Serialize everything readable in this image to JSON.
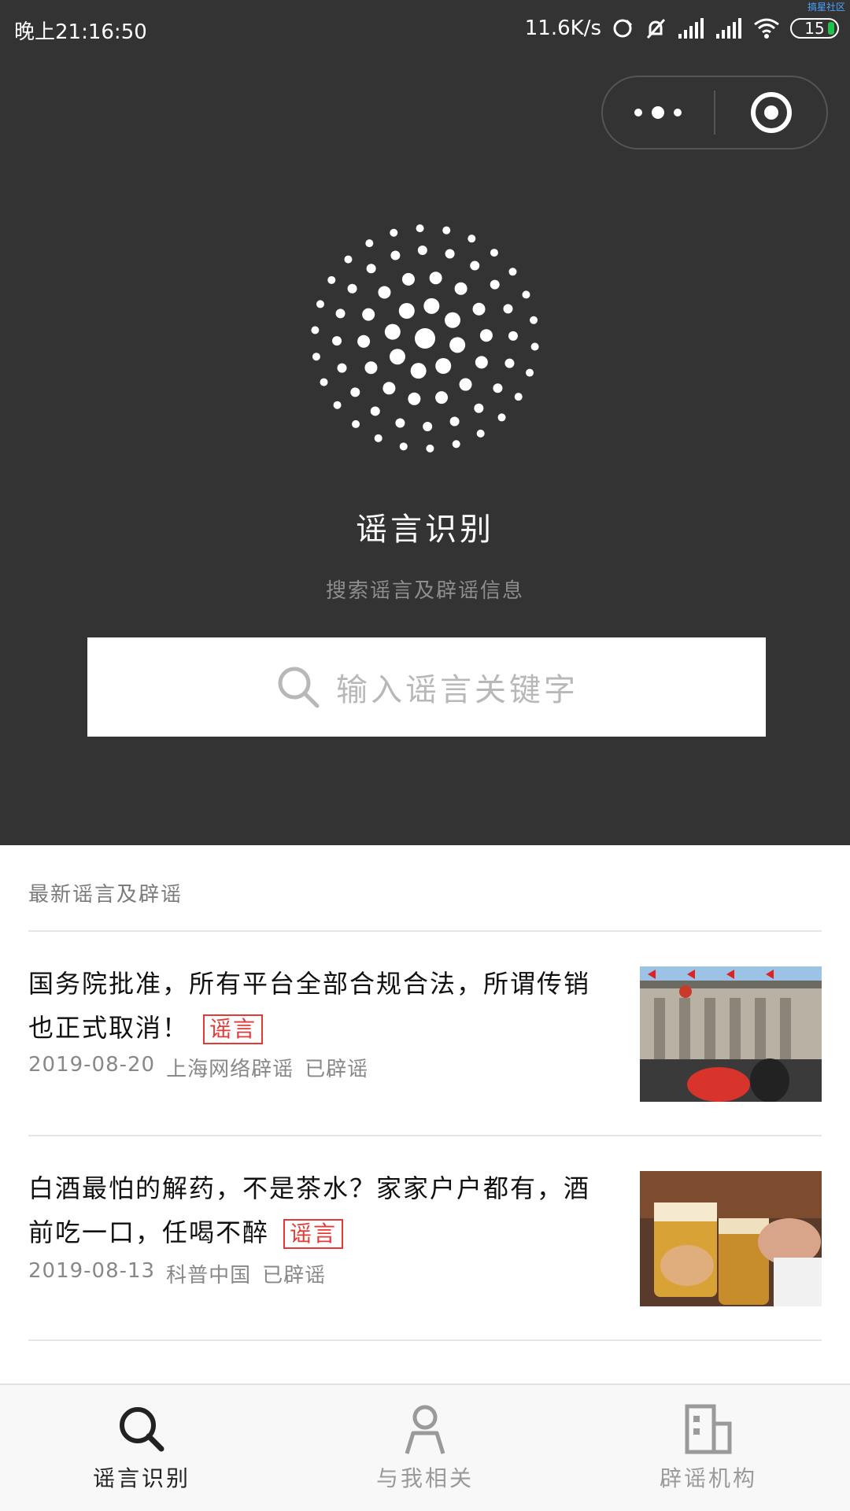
{
  "status_bar": {
    "time": "晚上21:16:50",
    "net_speed": "11.6K/s",
    "battery": "15",
    "corner_note": "搞星社区"
  },
  "capsule": {
    "more_icon": "more-dots-icon",
    "close_icon": "target-circle-icon"
  },
  "hero": {
    "title": "谣言识别",
    "subtitle": "搜索谣言及辟谣信息",
    "search_placeholder": "输入谣言关键字"
  },
  "latest": {
    "section_title": "最新谣言及辟谣",
    "items": [
      {
        "headline": "国务院批准，所有平台全部合规合法，所谓传销也正式取消！",
        "tag": "谣言",
        "date": "2019-08-20",
        "source": "上海网络辟谣",
        "status": "已辟谣"
      },
      {
        "headline": "白酒最怕的解药，不是茶水？家家户户都有，酒前吃一口，任喝不醉",
        "tag": "谣言",
        "date": "2019-08-13",
        "source": "科普中国",
        "status": "已辟谣"
      }
    ]
  },
  "tabbar": {
    "tabs": [
      {
        "label": "谣言识别",
        "icon": "search-icon",
        "active": true
      },
      {
        "label": "与我相关",
        "icon": "person-icon",
        "active": false
      },
      {
        "label": "辟谣机构",
        "icon": "building-icon",
        "active": false
      }
    ]
  },
  "colors": {
    "header_bg": "#333333",
    "tag_red": "#e53935",
    "battery_green": "#21c14b"
  }
}
